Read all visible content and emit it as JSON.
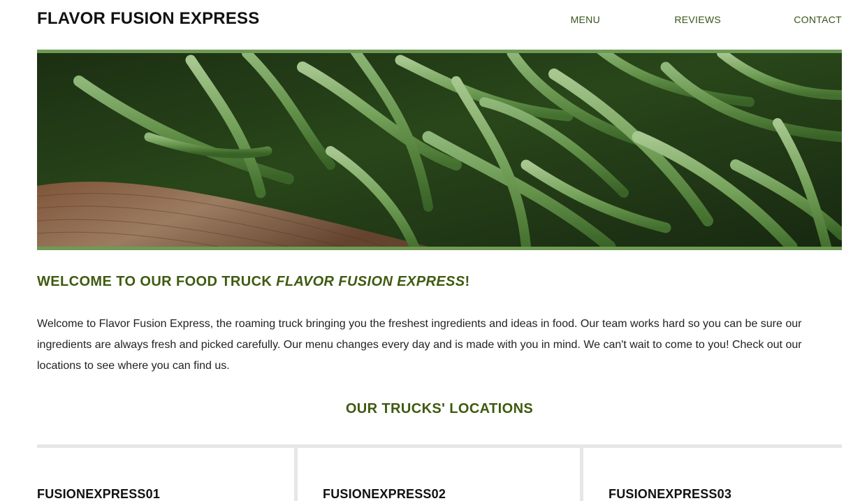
{
  "header": {
    "brand": "FLAVOR FUSION EXPRESS",
    "nav": [
      {
        "label": "MENU"
      },
      {
        "label": "REVIEWS"
      },
      {
        "label": "CONTACT"
      }
    ]
  },
  "hero": {
    "image": "green-beans-photo"
  },
  "welcome": {
    "heading_prefix": "WELCOME TO OUR FOOD TRUCK ",
    "heading_name": "FLAVOR FUSION EXPRESS",
    "heading_suffix": "!",
    "body": "Welcome to Flavor Fusion Express, the roaming truck bringing you the freshest ingredients and ideas in food. Our team works hard so you can be sure our ingredients are always fresh and picked carefully. Our menu changes every day and is made with you in mind. We can't wait to come to you! Check out our locations to see where you can find us."
  },
  "locations": {
    "heading": "OUR TRUCKS' LOCATIONS",
    "trucks": [
      {
        "name": "FUSIONEXPRESS01"
      },
      {
        "name": "FUSIONEXPRESS02"
      },
      {
        "name": "FUSIONEXPRESS03"
      }
    ]
  },
  "colors": {
    "accent_green": "#3f5a10",
    "nav_green": "#385418",
    "hero_border": "#6f9a55",
    "divider_gray": "#e6e6e6"
  }
}
